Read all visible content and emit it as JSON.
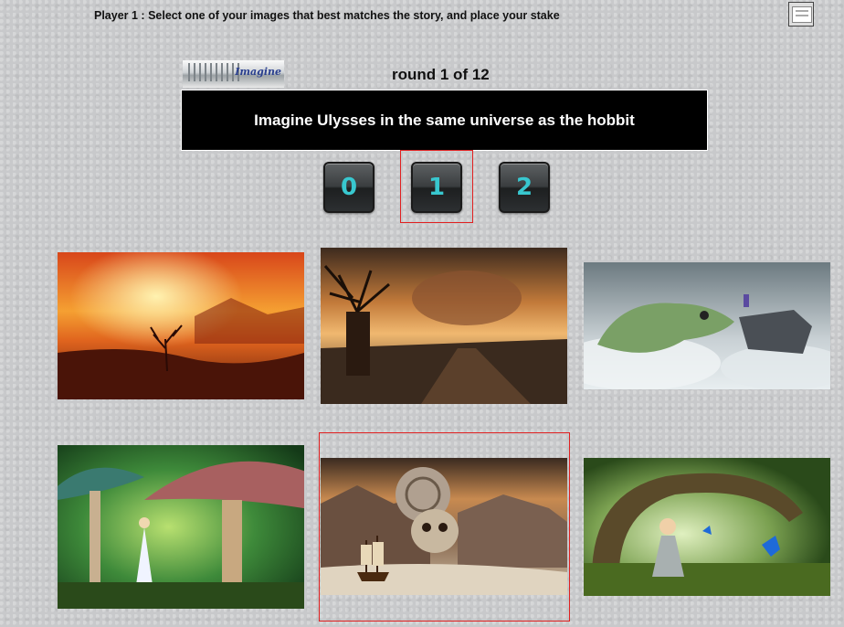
{
  "header": {
    "instruction": "Player 1 : Select one of your images that best matches the story, and place your stake",
    "menu_icon": "window-icon",
    "logo_text": "Imagine"
  },
  "round": {
    "label": "round 1 of 12"
  },
  "story": {
    "text": "Imagine Ulysses in the same universe as the hobbit"
  },
  "stakes": {
    "options": [
      "0",
      "1",
      "2"
    ],
    "selected": "1",
    "digit_color": "#38c7cf",
    "selection_color": "#e02020"
  },
  "cards": [
    {
      "id": "card-1",
      "subject": "sunset-dead-tree"
    },
    {
      "id": "card-2",
      "subject": "baobab-storm-road"
    },
    {
      "id": "card-3",
      "subject": "lizard-on-cliff-with-boy"
    },
    {
      "id": "card-4",
      "subject": "mushroom-forest-alice"
    },
    {
      "id": "card-5",
      "subject": "skull-shell-ship",
      "selected": true
    },
    {
      "id": "card-6",
      "subject": "fairy-under-tree-arch"
    }
  ]
}
